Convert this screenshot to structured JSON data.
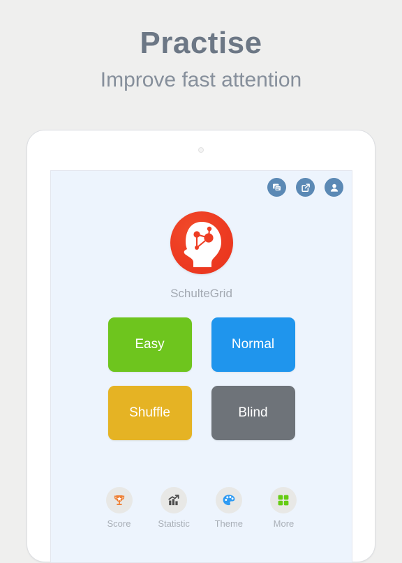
{
  "promo": {
    "title": "Practise",
    "subtitle": "Improve fast attention",
    "title_color": "#6c7785",
    "subtitle_color": "#868f9b",
    "background_color": "#efefee"
  },
  "device": {
    "type": "tablet",
    "frame_color": "#ffffff",
    "camera_icon": "camera-dot"
  },
  "app": {
    "name": "SchulteGrid",
    "screen_background": "#edf4fd",
    "logo": {
      "icon": "brain-head-logo-icon",
      "color": "#ee3d23"
    },
    "top_icons": [
      {
        "name": "feedback-icon",
        "label": "Feedback",
        "color": "#5b89b5"
      },
      {
        "name": "share-icon",
        "label": "Share",
        "color": "#5b89b5"
      },
      {
        "name": "account-icon",
        "label": "Account",
        "color": "#5b89b5"
      }
    ],
    "modes": [
      {
        "label": "Easy",
        "color": "#6ec51e",
        "text_color": "#ffffff"
      },
      {
        "label": "Normal",
        "color": "#1f95ed",
        "text_color": "#ffffff"
      },
      {
        "label": "Shuffle",
        "color": "#e5b324",
        "text_color": "#ffffff"
      },
      {
        "label": "Blind",
        "color": "#6e7379",
        "text_color": "#ffffff"
      }
    ],
    "toolbar": [
      {
        "label": "Score",
        "icon": "trophy-icon",
        "color": "#ef8136"
      },
      {
        "label": "Statistic",
        "icon": "bar-chart-icon",
        "color": "#4c4c4c"
      },
      {
        "label": "Theme",
        "icon": "palette-icon",
        "color": "#2f9bf3"
      },
      {
        "label": "More",
        "icon": "grid-squares-icon",
        "color": "#66cc14"
      }
    ]
  }
}
